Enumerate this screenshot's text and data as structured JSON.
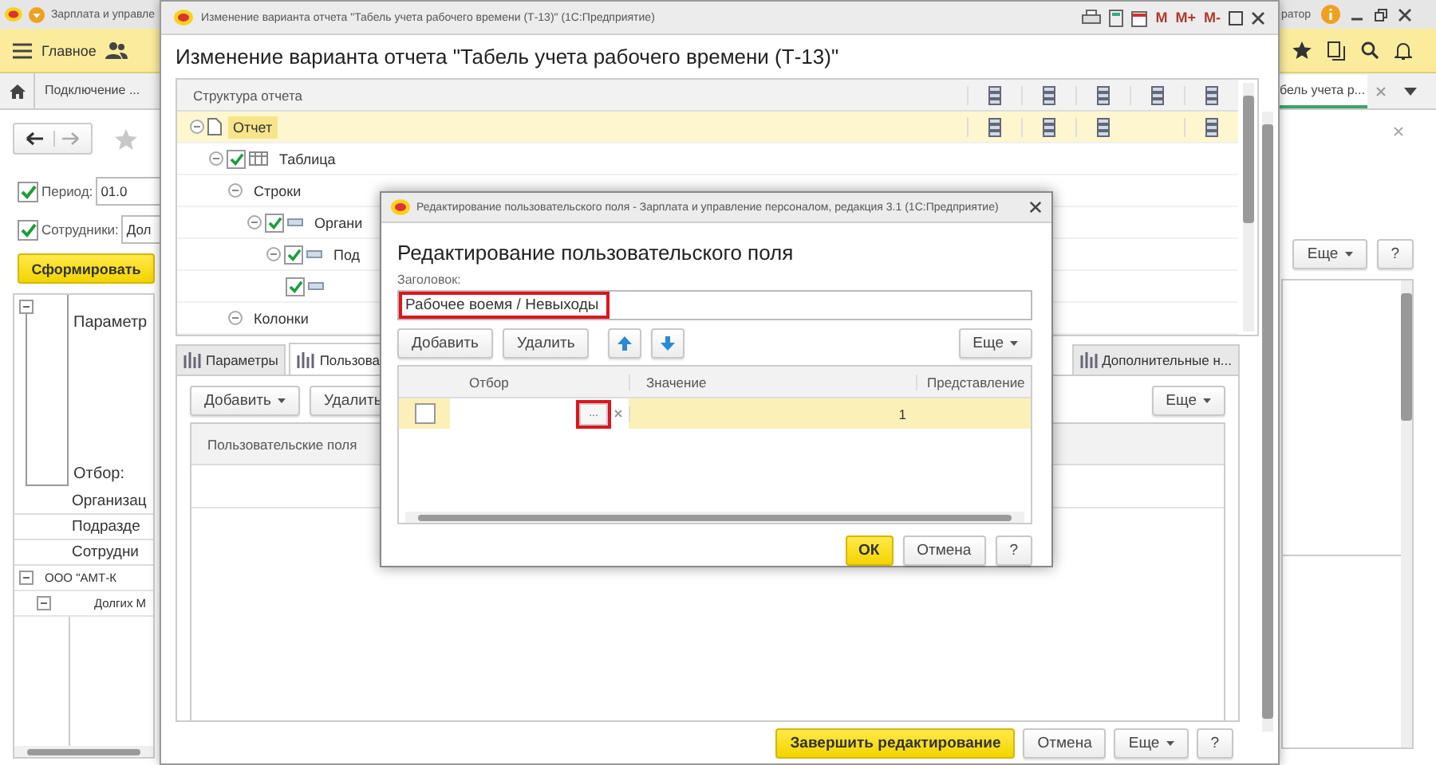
{
  "app": {
    "title": "Зарплата и управле",
    "user": "ратор",
    "section": "Главное",
    "tabs": [
      {
        "label": "Подключение ...",
        "selected": false
      },
      {
        "label": "бель учета р...",
        "selected": true
      }
    ],
    "filters": [
      {
        "label": "Период:",
        "value": "01.0",
        "checked": true
      },
      {
        "label": "Сотрудники:",
        "value": "Дол",
        "checked": true
      }
    ],
    "generate_button": "Сформировать",
    "report": {
      "header": "Параметр",
      "filter_label": "Отбор:",
      "filter_lines": [
        "Организац",
        "Подразде",
        "Сотрудни"
      ],
      "rows": [
        "ООО \"АМТ-К",
        "Долгих М"
      ]
    },
    "more_button": "Еще",
    "help_button": "?"
  },
  "editor": {
    "title": "Изменение варианта отчета \"Табель учета рабочего времени (Т-13)\" (1С:Предприятие)",
    "memory_buttons": [
      "M",
      "M+",
      "M-"
    ],
    "heading": "Изменение варианта отчета \"Табель учета рабочего времени (Т-13)\"",
    "structure": {
      "column": "Структура отчета",
      "rows": [
        {
          "label": "Отчет",
          "kind": "report",
          "expanded": true,
          "selected": true,
          "children": [
            {
              "label": "Таблица",
              "kind": "table",
              "checked": true,
              "expanded": true,
              "selected": false,
              "children": [
                {
                  "label": "Строки",
                  "expanded": true,
                  "selected": false,
                  "children": [
                    {
                      "label": "Органи",
                      "kind": "grouping",
                      "checked": true,
                      "expanded": true,
                      "selected": false,
                      "children": [
                        {
                          "label": "Под",
                          "kind": "grouping",
                          "checked": true,
                          "expanded": true,
                          "selected": false,
                          "children": [
                            {
                              "kind": "grouping",
                              "checked": true,
                              "selected": false
                            }
                          ]
                        }
                      ]
                    }
                  ]
                },
                {
                  "label": "Колонки",
                  "expanded": true,
                  "selected": false
                }
              ]
            }
          ]
        }
      ]
    },
    "tabs": [
      {
        "label": "Параметры",
        "selected": false
      },
      {
        "label": "Пользова",
        "selected": true
      },
      {
        "label": "Дополнительные н...",
        "selected": false
      }
    ],
    "toolbar": {
      "add": "Добавить",
      "delete": "Удалить",
      "more": "Еще"
    },
    "table_column": "Пользовательские поля",
    "footer": {
      "finish": "Завершить редактирование",
      "cancel": "Отмена",
      "more": "Еще",
      "help": "?"
    }
  },
  "dialog": {
    "title": "Редактирование пользовательского поля - Зарплата и управление персоналом, редакция 3.1 (1С:Предприятие)",
    "heading": "Редактирование пользовательского поля",
    "field_label": "Заголовок:",
    "field_value": "Рабочее воемя / Невыходы",
    "toolbar": {
      "add": "Добавить",
      "delete": "Удалить",
      "more": "Еще"
    },
    "columns": [
      "Отбор",
      "Значение",
      "Представление"
    ],
    "rows": [
      {
        "checked": false,
        "selected": true,
        "choose_button": "...",
        "value": "1"
      }
    ],
    "footer": {
      "ok": "ОК",
      "cancel": "Отмена",
      "help": "?"
    }
  }
}
